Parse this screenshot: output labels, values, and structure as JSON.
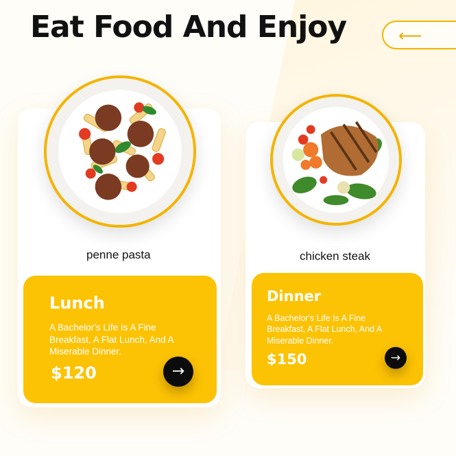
{
  "header": {
    "title": "Eat Food And Enjoy",
    "back_icon": "arrow-left-icon",
    "back_glyph": "⟵"
  },
  "colors": {
    "accent": "#fcc204",
    "border_accent": "#f4b400",
    "text": "#111111",
    "button": "#0c0c0c"
  },
  "cards": [
    {
      "dish": "penne pasta",
      "meal": "Lunch",
      "description": "A Bachelor's Life Is A Fine Breakfast, A Flat Lunch, And A Miserable Dinner.",
      "price": "$120",
      "button_icon": "arrow-right-icon",
      "button_glyph": "→"
    },
    {
      "dish": "chicken steak",
      "meal": "Dinner",
      "description": "A Bachelor's Life Is A Fine Breakfast, A Flat Lunch, And A Miserable Dinner.",
      "price": "$150",
      "button_icon": "arrow-right-icon",
      "button_glyph": "→"
    }
  ]
}
